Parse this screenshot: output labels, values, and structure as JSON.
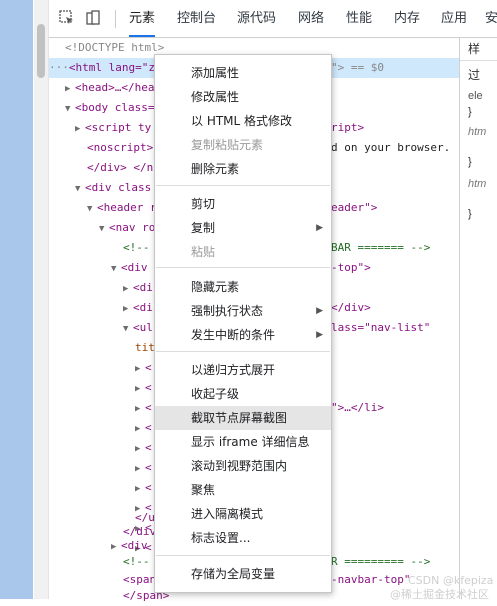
{
  "toolbar": {
    "tabs": [
      {
        "label": "元素",
        "active": true
      },
      {
        "label": "控制台"
      },
      {
        "label": "源代码"
      },
      {
        "label": "网络"
      },
      {
        "label": "性能"
      },
      {
        "label": "内存"
      },
      {
        "label": "应用"
      },
      {
        "label": "安"
      }
    ]
  },
  "tree": {
    "doctype": "<!DOCTYPE html>",
    "html_open": "<html lang=\"zh",
    "html_end": "\"> == $0",
    "head": "<head>…</hea",
    "body": "<body class=",
    "script_ty": "<script ty",
    "script_tail": "ript>",
    "noscript": "<noscript>",
    "noscript_tail": "d on your browser.",
    "div_close": "</div> </n",
    "div_class": "<div class",
    "header": "<header r",
    "header_tail": "eader\">",
    "nav": "<nav ro",
    "comment1": "<!--",
    "comment1_tail": "BAR ======= -->",
    "div2": "<div",
    "div2_tail": "-top\">",
    "di1": "<di",
    "di2": "<di",
    "di2_tail": "</div>",
    "ul": "<ul",
    "ul_tail": "lass=\"nav-list\"",
    "tit": "tit",
    "li_tail": "\">…</li>",
    "u_close": "</u",
    "div_close2": "</div",
    "div3": "<div",
    "comment2": "<!--",
    "comment2_tail": "R ========= -->",
    "span": "<span",
    "span_tail": "-navbar-top\"",
    "span_close": "</span>"
  },
  "side": {
    "header": "样",
    "filter": "过",
    "ele": "ele",
    "brace_close": "}",
    "htm1": "htm",
    "htm2": "htm"
  },
  "menu": {
    "items": [
      {
        "label": "添加属性"
      },
      {
        "label": "修改属性"
      },
      {
        "label": "以 HTML 格式修改"
      },
      {
        "label": "复制粘贴元素",
        "disabled": true
      },
      {
        "label": "删除元素"
      },
      {
        "label": "剪切"
      },
      {
        "label": "复制",
        "submenu": true
      },
      {
        "label": "粘贴",
        "disabled": true
      },
      {
        "label": "隐藏元素"
      },
      {
        "label": "强制执行状态",
        "submenu": true
      },
      {
        "label": "发生中断的条件",
        "submenu": true
      },
      {
        "label": "以递归方式展开"
      },
      {
        "label": "收起子级"
      },
      {
        "label": "截取节点屏幕截图",
        "highlighted": true
      },
      {
        "label": "显示 iframe 详细信息"
      },
      {
        "label": "滚动到视野范围内"
      },
      {
        "label": "聚焦"
      },
      {
        "label": "进入隔离模式"
      },
      {
        "label": "标志设置..."
      },
      {
        "label": "存储为全局变量"
      }
    ]
  },
  "watermark": {
    "csdn": "CSDN @kfepiza",
    "juejin": "@稀土掘金技术社区"
  }
}
